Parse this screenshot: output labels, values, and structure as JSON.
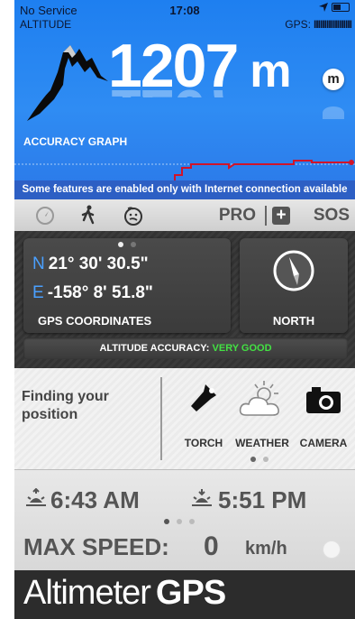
{
  "status_bar": {
    "carrier": "No Service",
    "time": "17:08"
  },
  "header": {
    "altitude_label": "ALTITUDE",
    "gps_label": "GPS:",
    "gps_bars": "IIIIIIIIIIIIIIIIII",
    "altitude_value": "1207",
    "altitude_unit": "m",
    "unit_toggle": "m",
    "accuracy_graph_label": "ACCURACY GRAPH",
    "notice": "Some features are enabled only with Internet connection available"
  },
  "toolbar": {
    "pro_label": "PRO",
    "sos_label": "SOS",
    "plus_symbol": "+"
  },
  "coordinates": {
    "lat_dir": "N",
    "lat_value": "21° 30' 30.5\"",
    "lon_dir": "E",
    "lon_value": "-158° 8' 51.8\"",
    "label": "GPS COORDINATES"
  },
  "compass": {
    "label": "NORTH"
  },
  "accuracy": {
    "label": "ALTITUDE ACCURACY:",
    "value": "VERY GOOD",
    "value_color": "#43e043"
  },
  "position": {
    "line1": "Finding your",
    "line2": "position"
  },
  "tools": [
    {
      "label": "TORCH",
      "icon": "torch-icon"
    },
    {
      "label": "WEATHER",
      "icon": "weather-icon"
    },
    {
      "label": "CAMERA",
      "icon": "camera-icon"
    }
  ],
  "sun": {
    "sunrise": "6:43 AM",
    "sunset": "5:51 PM"
  },
  "speed": {
    "label": "MAX SPEED:",
    "value": "0",
    "unit": "km/h"
  },
  "brand": {
    "name": "Altimeter",
    "suffix": "GPS"
  },
  "colors": {
    "sky": "#2f8cf3",
    "notice_bar": "#2d5fc4",
    "graph_line": "#d0142a",
    "panel_dark": "#3b3b3b"
  }
}
